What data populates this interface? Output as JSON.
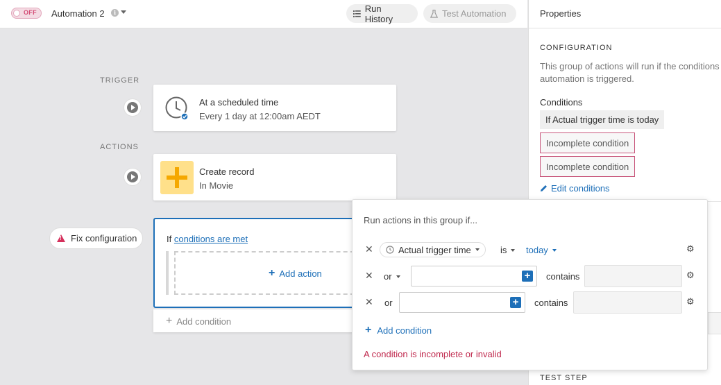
{
  "header": {
    "toggle_label": "OFF",
    "automation_name": "Automation 2",
    "run_history": "Run History",
    "test_automation": "Test Automation"
  },
  "canvas": {
    "trigger_label": "TRIGGER",
    "actions_label": "ACTIONS",
    "trigger_card": {
      "title": "At a scheduled time",
      "subtitle": "Every 1 day at 12:00am AEDT"
    },
    "action_card": {
      "title": "Create record",
      "subtitle": "In Movie"
    },
    "fix_config": "Fix configuration",
    "group": {
      "if_text": "If",
      "conditions_link": "conditions are met",
      "add_action": "Add action"
    },
    "add_condition": "Add condition"
  },
  "popover": {
    "title": "Run actions in this group if...",
    "rows": [
      {
        "conjunction": "",
        "field": "Actual trigger time",
        "operator": "is",
        "value": "today"
      },
      {
        "conjunction": "or",
        "field": "",
        "operator": "contains",
        "value": ""
      },
      {
        "conjunction": "or",
        "field": "",
        "operator": "contains",
        "value": ""
      }
    ],
    "add_condition": "Add condition",
    "error": "A condition is incomplete or invalid"
  },
  "properties": {
    "title": "Properties",
    "configuration_heading": "CONFIGURATION",
    "description": "This group of actions will run if the conditions are met when the automation is triggered.",
    "description_line1": "This group of actions will run if the conditions",
    "description_line2": "automation is triggered.",
    "conditions_label": "Conditions",
    "condition_chip": "If Actual trigger time is today",
    "incomplete_1": "Incomplete condition",
    "incomplete_2": "Incomplete condition",
    "edit_conditions": "Edit conditions",
    "test_step_heading": "TEST STEP"
  },
  "colors": {
    "accent": "#1d6fb8",
    "error": "#c02a4e",
    "trigger_icon_bg": "#ffe08a"
  }
}
